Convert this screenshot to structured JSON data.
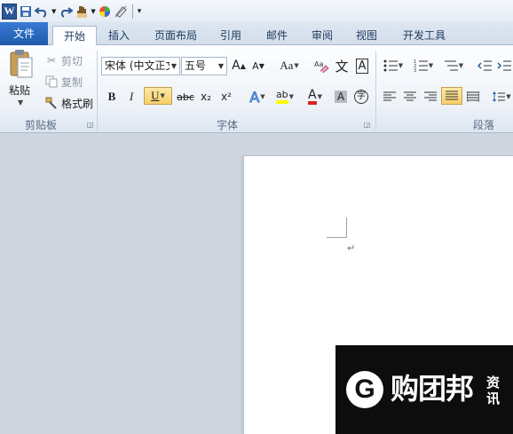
{
  "qat": {
    "app_logo": "W",
    "overflow_glyph": "▾"
  },
  "tabs": {
    "file": "文件",
    "home": "开始",
    "insert": "插入",
    "page_layout": "页面布局",
    "references": "引用",
    "mailings": "邮件",
    "review": "审阅",
    "view": "视图",
    "developer": "开发工具"
  },
  "clipboard": {
    "group_label": "剪贴板",
    "paste": "粘贴",
    "cut": "剪切",
    "copy": "复制",
    "format_painter": "格式刷"
  },
  "font": {
    "group_label": "字体",
    "font_name": "宋体 (中文正文",
    "font_size": "五号",
    "grow_glyph": "A",
    "shrink_glyph": "A",
    "change_case": "Aa",
    "bold": "B",
    "italic": "I",
    "underline": "U",
    "strikethrough": "abc",
    "subscript": "x₂",
    "superscript": "x²",
    "text_effects": "A",
    "font_color": "A",
    "char_shading": "A",
    "enclose_char": "字",
    "phonetic_guide": "文",
    "char_border": "A"
  },
  "paragraph": {
    "group_label": "段落"
  },
  "watermark": {
    "logo_letter": "G",
    "brand": "购团邦",
    "side_text": "资讯"
  },
  "colors": {
    "file_tab": "#2b6cc4",
    "font_color_bar": "#e02020",
    "highlight_bar": "#ffff00",
    "pressed_button": "#f8cf6a"
  }
}
